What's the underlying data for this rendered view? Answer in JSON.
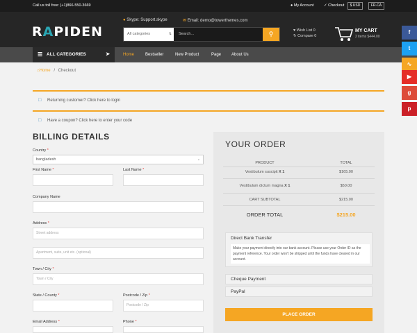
{
  "topbar": {
    "call": "Call us toll free: (+1)866-550-3669",
    "my_account": "My Account",
    "checkout": "Checkout",
    "currency": "$ USD",
    "language": "FR-CA"
  },
  "header": {
    "logo": "RAPIDEN",
    "logo_first": "R",
    "logo_mark": "A",
    "logo_rest": "PIDEN",
    "skype": "Skype: Support.skype",
    "email": "Email: demo@towerthemes.com",
    "search_category": "All categories",
    "search_placeholder": "Search...",
    "wishlist": "Wish List 0",
    "compare": "Compare 0",
    "cart_title": "MY CART",
    "cart_sub": "2 items $444.00"
  },
  "nav": {
    "all_categories": "ALL CATEGORIES",
    "items": [
      "Home",
      "Bestseller",
      "New Product",
      "Page",
      "About Us"
    ],
    "active": "Home"
  },
  "social": [
    "facebook-icon",
    "twitter-icon",
    "rss-icon",
    "youtube-icon",
    "google-plus-icon",
    "pinterest-icon"
  ],
  "breadcrumb": {
    "home": "Home",
    "sep": "/",
    "current": "Checkout"
  },
  "notices": {
    "login": "Returning customer? Click here to login",
    "coupon": "Have a coupon? Click here to enter your code"
  },
  "billing": {
    "title": "BILLING DETAILS",
    "country_label": "Country",
    "country_value": "bangladesh",
    "first_name": "First Name",
    "last_name": "Last Name",
    "company": "Company Name",
    "address": "Address",
    "address_ph": "Street address",
    "address2_ph": "Apartment, suite, unit etc. (optional)",
    "town": "Town / City",
    "town_ph": "Town / City",
    "state": "State / County",
    "postcode": "Postcode / Zip",
    "postcode_ph": "Postcode / Zip",
    "email": "Email Address",
    "phone": "Phone",
    "required_mark": "*"
  },
  "order": {
    "title": "YOUR ORDER",
    "col_product": "PRODUCT",
    "col_total": "TOTAL",
    "items": [
      {
        "name": "Vestibulum suscipit",
        "qty": "X 1",
        "total": "$165.00"
      },
      {
        "name": "Vestibulum dictum magna",
        "qty": "X 1",
        "total": "$50.00"
      }
    ],
    "subtotal_label": "CART SUBTOTAL",
    "subtotal": "$215.00",
    "total_label": "ORDER TOTAL",
    "total": "$215.00",
    "payments": {
      "bank": "Direct Bank Transfer",
      "bank_desc": "Make your payment directly into our bank account. Please use your Order ID as the payment reference. Your order won't be shipped until the funds have cleared in our account.",
      "cheque": "Cheque Payment",
      "paypal": "PayPal"
    },
    "place_order": "PLACE ORDER"
  },
  "colors": {
    "accent": "#f5a623",
    "dark": "#262626",
    "nav": "#4a4a4a"
  }
}
